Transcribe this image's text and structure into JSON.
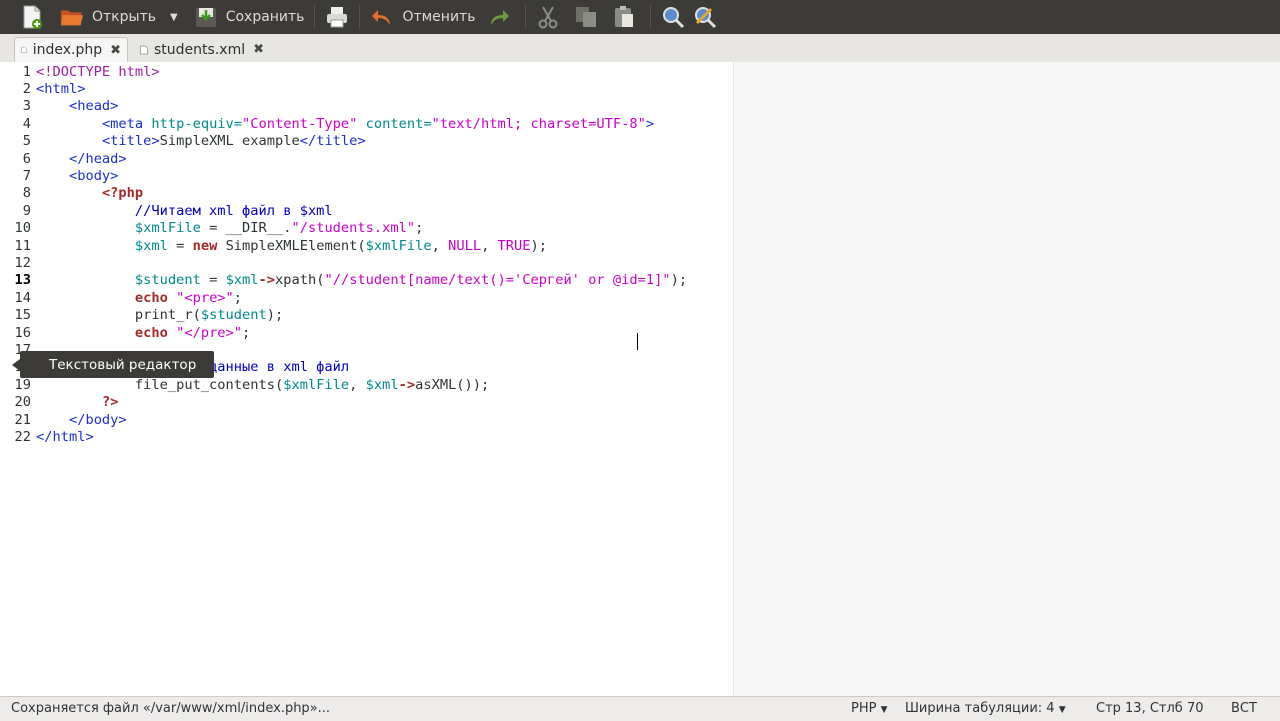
{
  "toolbar": {
    "open_label": "Открыть",
    "save_label": "Сохранить",
    "undo_label": "Отменить"
  },
  "tabs": [
    {
      "label": "index.php",
      "active": true
    },
    {
      "label": "students.xml",
      "active": false
    }
  ],
  "editor": {
    "current_line": 13,
    "lines": [
      {
        "n": "1",
        "segments": [
          {
            "t": "<!DOCTYPE html>",
            "c": "#a020a0"
          }
        ]
      },
      {
        "n": "2",
        "segments": [
          {
            "t": "<html>",
            "c": "#1d2fd0"
          }
        ]
      },
      {
        "n": "3",
        "segments": [
          {
            "t": "    "
          },
          {
            "t": "<head>",
            "c": "#1d2fd0"
          }
        ]
      },
      {
        "n": "4",
        "segments": [
          {
            "t": "        "
          },
          {
            "t": "<meta",
            "c": "#1d2fd0"
          },
          {
            "t": " http-equiv=",
            "c": "#008a8c"
          },
          {
            "t": "\"Content-Type\"",
            "c": "#cc00cc"
          },
          {
            "t": " content=",
            "c": "#008a8c"
          },
          {
            "t": "\"text/html; charset=UTF-8\"",
            "c": "#cc00cc"
          },
          {
            "t": ">",
            "c": "#1d2fd0"
          }
        ]
      },
      {
        "n": "5",
        "segments": [
          {
            "t": "        "
          },
          {
            "t": "<title>",
            "c": "#1d2fd0"
          },
          {
            "t": "SimpleXML example"
          },
          {
            "t": "</title>",
            "c": "#1d2fd0"
          }
        ]
      },
      {
        "n": "6",
        "segments": [
          {
            "t": "    "
          },
          {
            "t": "</head>",
            "c": "#1d2fd0"
          }
        ]
      },
      {
        "n": "7",
        "segments": [
          {
            "t": "    "
          },
          {
            "t": "<body>",
            "c": "#1d2fd0"
          }
        ]
      },
      {
        "n": "8",
        "segments": [
          {
            "t": "        "
          },
          {
            "t": "<?php",
            "c": "#a52a2a",
            "b": true
          }
        ]
      },
      {
        "n": "9",
        "segments": [
          {
            "t": "            "
          },
          {
            "t": "//Читаем xml файл в $xml",
            "c": "#0000c8"
          }
        ]
      },
      {
        "n": "10",
        "segments": [
          {
            "t": "            "
          },
          {
            "t": "$xmlFile",
            "c": "#008a8c"
          },
          {
            "t": " = __DIR__."
          },
          {
            "t": "\"/students.xml\"",
            "c": "#cc00cc"
          },
          {
            "t": ";"
          }
        ]
      },
      {
        "n": "11",
        "segments": [
          {
            "t": "            "
          },
          {
            "t": "$xml",
            "c": "#008a8c"
          },
          {
            "t": " = "
          },
          {
            "t": "new",
            "c": "#a52a2a",
            "b": true
          },
          {
            "t": " SimpleXMLElement("
          },
          {
            "t": "$xmlFile",
            "c": "#008a8c"
          },
          {
            "t": ", "
          },
          {
            "t": "NULL",
            "c": "#cc00cc"
          },
          {
            "t": ", "
          },
          {
            "t": "TRUE",
            "c": "#cc00cc"
          },
          {
            "t": ");"
          }
        ]
      },
      {
        "n": "12",
        "segments": []
      },
      {
        "n": "13",
        "segments": [
          {
            "t": "            "
          },
          {
            "t": "$student",
            "c": "#008a8c"
          },
          {
            "t": " = "
          },
          {
            "t": "$xml",
            "c": "#008a8c"
          },
          {
            "t": "->",
            "c": "#a52a2a",
            "b": true
          },
          {
            "t": "xpath("
          },
          {
            "t": "\"//student[name/text()='Сергей' or @id=1]\"",
            "c": "#cc00cc"
          },
          {
            "t": ");"
          }
        ]
      },
      {
        "n": "14",
        "segments": [
          {
            "t": "            "
          },
          {
            "t": "echo",
            "c": "#a52a2a",
            "b": true
          },
          {
            "t": " "
          },
          {
            "t": "\"<pre>\"",
            "c": "#cc00cc"
          },
          {
            "t": ";"
          }
        ]
      },
      {
        "n": "15",
        "segments": [
          {
            "t": "            "
          },
          {
            "t": "print_r("
          },
          {
            "t": "$student",
            "c": "#008a8c"
          },
          {
            "t": ");"
          }
        ]
      },
      {
        "n": "16",
        "segments": [
          {
            "t": "            "
          },
          {
            "t": "echo",
            "c": "#a52a2a",
            "b": true
          },
          {
            "t": " "
          },
          {
            "t": "\"</pre>\"",
            "c": "#cc00cc"
          },
          {
            "t": ";"
          }
        ]
      },
      {
        "n": "17",
        "segments": []
      },
      {
        "n": "18",
        "segments": [
          {
            "t": "            "
          },
          {
            "t": "//Записи данные в xml файл",
            "c": "#0000c8"
          }
        ]
      },
      {
        "n": "19",
        "segments": [
          {
            "t": "            "
          },
          {
            "t": "file_put_contents("
          },
          {
            "t": "$xmlFile",
            "c": "#008a8c"
          },
          {
            "t": ", "
          },
          {
            "t": "$xml",
            "c": "#008a8c"
          },
          {
            "t": "->",
            "c": "#a52a2a",
            "b": true
          },
          {
            "t": "asXML());"
          }
        ]
      },
      {
        "n": "20",
        "segments": [
          {
            "t": "        "
          },
          {
            "t": "?>",
            "c": "#a52a2a",
            "b": true
          }
        ]
      },
      {
        "n": "21",
        "segments": [
          {
            "t": "    "
          },
          {
            "t": "</body>",
            "c": "#1d2fd0"
          }
        ]
      },
      {
        "n": "22",
        "segments": [
          {
            "t": "</html>",
            "c": "#1d2fd0"
          }
        ]
      }
    ]
  },
  "tooltip": {
    "text": "Текстовый редактор"
  },
  "status": {
    "message": "Сохраняется файл «/var/www/xml/index.php»...",
    "language": "PHP",
    "tab_width": "Ширина табуляции:  4",
    "position": "Стр 13, Стлб 70",
    "mode": "ВСТ"
  }
}
